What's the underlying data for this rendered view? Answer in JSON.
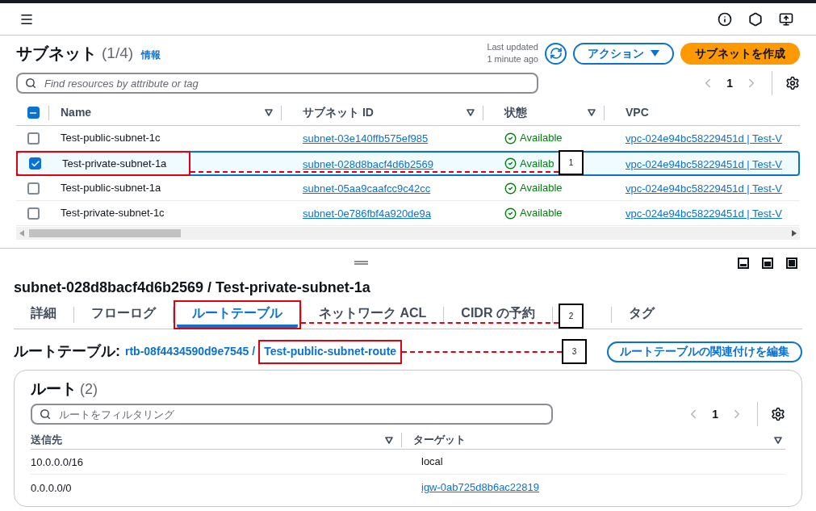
{
  "subnets": {
    "title": "サブネット",
    "count": "(1/4)",
    "info_link": "情報",
    "last_updated": [
      "Last updated",
      "1 minute ago"
    ],
    "actions_button": "アクション",
    "create_button": "サブネットを作成",
    "search": {
      "placeholder": "Find resources by attribute or tag"
    },
    "page": "1",
    "select_all_partial": true,
    "columns": [
      "Name",
      "サブネット ID",
      "状態",
      "VPC"
    ],
    "rows": [
      {
        "name": "Test-public-subnet-1c",
        "id": "subnet-03e140ffb575ef985",
        "status": "Available",
        "vpc": "vpc-024e94bc58229451d | Test-V",
        "selected": false
      },
      {
        "name": "Test-private-subnet-1a",
        "id": "subnet-028d8bacf4d6b2569",
        "status": "Availab",
        "vpc": "vpc-024e94bc58229451d | Test-V",
        "selected": true
      },
      {
        "name": "Test-public-subnet-1a",
        "id": "subnet-05aa9caafcc9c42cc",
        "status": "Available",
        "vpc": "vpc-024e94bc58229451d | Test-V",
        "selected": false
      },
      {
        "name": "Test-private-subnet-1c",
        "id": "subnet-0e786fbf4a920de9a",
        "status": "Available",
        "vpc": "vpc-024e94bc58229451d | Test-V",
        "selected": false
      }
    ]
  },
  "detail": {
    "title": "subnet-028d8bacf4d6b2569 / Test-private-subnet-1a",
    "tabs": [
      {
        "label": "詳細",
        "selected": false
      },
      {
        "label": "フローログ",
        "selected": false
      },
      {
        "label": "ルートテーブル",
        "selected": true
      },
      {
        "label": "ネットワーク ACL",
        "selected": false
      },
      {
        "label": "CIDR の予約",
        "selected": false
      },
      {
        "kind": "hidden"
      },
      {
        "label": "タグ",
        "selected": false
      }
    ],
    "route_table": {
      "label": "ルートテーブル:",
      "id": "rtb-08f4434590d9e7545",
      "separator": "/",
      "name": "Test-public-subnet-route",
      "edit_button": "ルートテーブルの関連付けを編集"
    },
    "routes": {
      "title": "ルート",
      "count": "(2)",
      "search": {
        "placeholder": "ルートをフィルタリング"
      },
      "page": "1",
      "columns": [
        "送信先",
        "ターゲット"
      ],
      "rows": [
        {
          "destination": "10.0.0.0/16",
          "target": "local",
          "kind": "text"
        },
        {
          "destination": "0.0.0.0/0",
          "target": "igw-0ab725d8b6ac22819",
          "kind": "link"
        }
      ]
    }
  },
  "annotations": [
    {
      "label": "1"
    },
    {
      "label": "2"
    },
    {
      "label": "3"
    }
  ]
}
